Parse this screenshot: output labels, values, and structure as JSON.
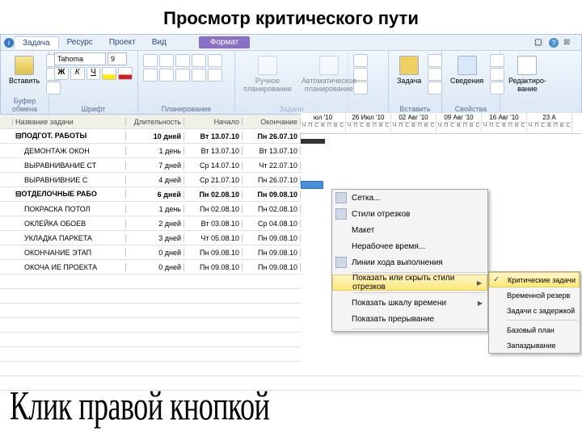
{
  "title_top": "Просмотр критического пути",
  "bottom_caption": "Клик правой кнопкой",
  "tabs": [
    "Задача",
    "Ресурс",
    "Проект",
    "Вид"
  ],
  "tab_format": "Формат",
  "ribbon": {
    "clipboard": {
      "paste": "Вставить",
      "label": "Буфер обмена"
    },
    "font": {
      "name": "Tahoma",
      "size": "9",
      "label": "Шрифт"
    },
    "schedule": {
      "label": "Планирование"
    },
    "tasks": {
      "manual": "Ручное\nпланирование",
      "auto": "Автоматическое\nпланирование",
      "label": "Задачи"
    },
    "insert": {
      "task": "Задача",
      "label": "Вставить"
    },
    "props": {
      "info": "Сведения",
      "label": "Свойства"
    },
    "edit": {
      "btn": "Редактиро-\nвание"
    }
  },
  "grid": {
    "headers": {
      "i": "i",
      "name": "Название задачи",
      "dur": "Длительность",
      "start": "Начало",
      "end": "Окончание"
    },
    "rows": [
      {
        "bold": true,
        "name": "ПОДГОТ. РАБОТЫ",
        "dur": "10 дней",
        "start": "Вт 13.07.10",
        "end": "Пн 26.07.10",
        "summary": true
      },
      {
        "name": "ДЕМОНТАЖ ОКОН",
        "dur": "1 день",
        "start": "Вт 13.07.10",
        "end": "Вт 13.07.10"
      },
      {
        "name": "ВЫРАВНИВАНИЕ СТ",
        "dur": "7 дней",
        "start": "Ср 14.07.10",
        "end": "Чт 22.07.10"
      },
      {
        "name": "ВЫРАВНИВНИЕ С",
        "dur": "4 дней",
        "start": "Ср 21.07.10",
        "end": "Пн 26.07.10"
      },
      {
        "bold": true,
        "name": "ОТДЕЛОЧНЫЕ РАБО",
        "dur": "6 дней",
        "start": "Пн 02.08.10",
        "end": "Пн 09.08.10",
        "summary": true
      },
      {
        "name": "ПОКРАСКА ПОТОЛ",
        "dur": "1 день",
        "start": "Пн 02.08.10",
        "end": "Пн 02.08.10"
      },
      {
        "name": "ОКЛЕЙКА ОБОЕВ",
        "dur": "2 дней",
        "start": "Вт 03.08.10",
        "end": "Ср 04.08.10"
      },
      {
        "name": "УКЛАДКА ПАРКЕТА",
        "dur": "3 дней",
        "start": "Чт 05.08.10",
        "end": "Пн 09.08.10"
      },
      {
        "name": "ОКОНЧАНИЕ ЭТАП",
        "dur": "0 дней",
        "start": "Пн 09.08.10",
        "end": "Пн 09.08.10"
      },
      {
        "name": "ОКОЧА ИЕ ПРОЕКТА",
        "dur": "0 дней",
        "start": "Пн 09.08.10",
        "end": "Пн 09.08.10"
      }
    ]
  },
  "gantt_weeks": [
    "юл '10",
    "26 Июл '10",
    "02 Авг '10",
    "09 Авг '10",
    "16 Авг '10",
    "23 А"
  ],
  "gantt_day_letters": [
    "Ч",
    "П",
    "С",
    "В",
    "П",
    "В",
    "С"
  ],
  "context_menu": [
    {
      "label": "Сетка...",
      "icon": true
    },
    {
      "label": "Стили отрезков",
      "icon": true
    },
    {
      "label": "Макет",
      "underline": "М"
    },
    {
      "label": "Нерабочее время...",
      "underline": "Н"
    },
    {
      "label": "Линии хода выполнения",
      "icon": true,
      "underline": "Л"
    },
    {
      "label": "Показать или скрыть стили отрезков",
      "hl": true,
      "arrow": true,
      "underline": "о"
    },
    {
      "label": "Показать шкалу времени",
      "arrow": true,
      "underline": "ш"
    },
    {
      "label": "Показать прерывание",
      "underline": "п"
    }
  ],
  "submenu": [
    {
      "label": "Критические задачи",
      "checked": true,
      "hl": true,
      "underline": "К"
    },
    {
      "label": "Временной резерв",
      "underline": "В"
    },
    {
      "label": "Задачи с задержкой",
      "underline": "З"
    },
    {
      "label": "Базовый план",
      "underline": "Б"
    },
    {
      "label": "Запаздывание",
      "underline": "п"
    }
  ]
}
